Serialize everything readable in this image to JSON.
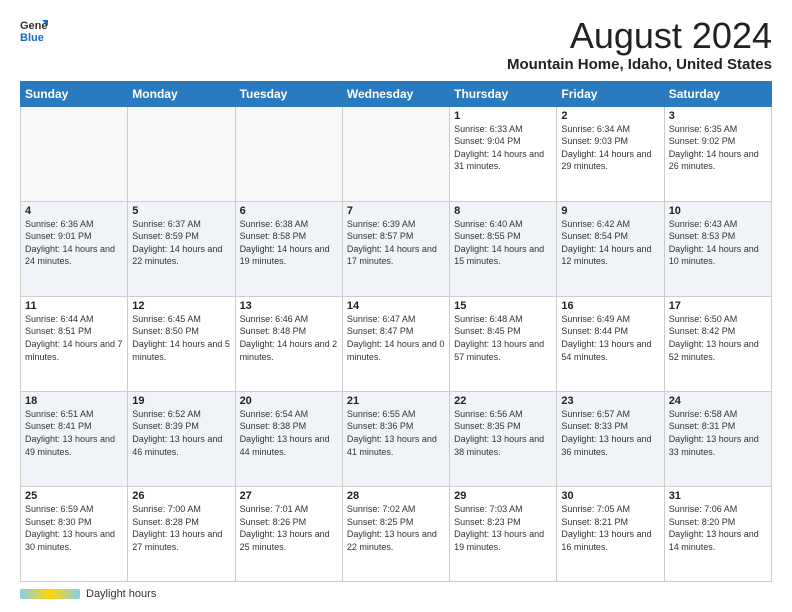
{
  "header": {
    "logo_general": "General",
    "logo_blue": "Blue",
    "main_title": "August 2024",
    "subtitle": "Mountain Home, Idaho, United States"
  },
  "days_of_week": [
    "Sunday",
    "Monday",
    "Tuesday",
    "Wednesday",
    "Thursday",
    "Friday",
    "Saturday"
  ],
  "weeks": [
    [
      {
        "day": "",
        "info": ""
      },
      {
        "day": "",
        "info": ""
      },
      {
        "day": "",
        "info": ""
      },
      {
        "day": "",
        "info": ""
      },
      {
        "day": "1",
        "info": "Sunrise: 6:33 AM\nSunset: 9:04 PM\nDaylight: 14 hours and 31 minutes."
      },
      {
        "day": "2",
        "info": "Sunrise: 6:34 AM\nSunset: 9:03 PM\nDaylight: 14 hours and 29 minutes."
      },
      {
        "day": "3",
        "info": "Sunrise: 6:35 AM\nSunset: 9:02 PM\nDaylight: 14 hours and 26 minutes."
      }
    ],
    [
      {
        "day": "4",
        "info": "Sunrise: 6:36 AM\nSunset: 9:01 PM\nDaylight: 14 hours and 24 minutes."
      },
      {
        "day": "5",
        "info": "Sunrise: 6:37 AM\nSunset: 8:59 PM\nDaylight: 14 hours and 22 minutes."
      },
      {
        "day": "6",
        "info": "Sunrise: 6:38 AM\nSunset: 8:58 PM\nDaylight: 14 hours and 19 minutes."
      },
      {
        "day": "7",
        "info": "Sunrise: 6:39 AM\nSunset: 8:57 PM\nDaylight: 14 hours and 17 minutes."
      },
      {
        "day": "8",
        "info": "Sunrise: 6:40 AM\nSunset: 8:55 PM\nDaylight: 14 hours and 15 minutes."
      },
      {
        "day": "9",
        "info": "Sunrise: 6:42 AM\nSunset: 8:54 PM\nDaylight: 14 hours and 12 minutes."
      },
      {
        "day": "10",
        "info": "Sunrise: 6:43 AM\nSunset: 8:53 PM\nDaylight: 14 hours and 10 minutes."
      }
    ],
    [
      {
        "day": "11",
        "info": "Sunrise: 6:44 AM\nSunset: 8:51 PM\nDaylight: 14 hours and 7 minutes."
      },
      {
        "day": "12",
        "info": "Sunrise: 6:45 AM\nSunset: 8:50 PM\nDaylight: 14 hours and 5 minutes."
      },
      {
        "day": "13",
        "info": "Sunrise: 6:46 AM\nSunset: 8:48 PM\nDaylight: 14 hours and 2 minutes."
      },
      {
        "day": "14",
        "info": "Sunrise: 6:47 AM\nSunset: 8:47 PM\nDaylight: 14 hours and 0 minutes."
      },
      {
        "day": "15",
        "info": "Sunrise: 6:48 AM\nSunset: 8:45 PM\nDaylight: 13 hours and 57 minutes."
      },
      {
        "day": "16",
        "info": "Sunrise: 6:49 AM\nSunset: 8:44 PM\nDaylight: 13 hours and 54 minutes."
      },
      {
        "day": "17",
        "info": "Sunrise: 6:50 AM\nSunset: 8:42 PM\nDaylight: 13 hours and 52 minutes."
      }
    ],
    [
      {
        "day": "18",
        "info": "Sunrise: 6:51 AM\nSunset: 8:41 PM\nDaylight: 13 hours and 49 minutes."
      },
      {
        "day": "19",
        "info": "Sunrise: 6:52 AM\nSunset: 8:39 PM\nDaylight: 13 hours and 46 minutes."
      },
      {
        "day": "20",
        "info": "Sunrise: 6:54 AM\nSunset: 8:38 PM\nDaylight: 13 hours and 44 minutes."
      },
      {
        "day": "21",
        "info": "Sunrise: 6:55 AM\nSunset: 8:36 PM\nDaylight: 13 hours and 41 minutes."
      },
      {
        "day": "22",
        "info": "Sunrise: 6:56 AM\nSunset: 8:35 PM\nDaylight: 13 hours and 38 minutes."
      },
      {
        "day": "23",
        "info": "Sunrise: 6:57 AM\nSunset: 8:33 PM\nDaylight: 13 hours and 36 minutes."
      },
      {
        "day": "24",
        "info": "Sunrise: 6:58 AM\nSunset: 8:31 PM\nDaylight: 13 hours and 33 minutes."
      }
    ],
    [
      {
        "day": "25",
        "info": "Sunrise: 6:59 AM\nSunset: 8:30 PM\nDaylight: 13 hours and 30 minutes."
      },
      {
        "day": "26",
        "info": "Sunrise: 7:00 AM\nSunset: 8:28 PM\nDaylight: 13 hours and 27 minutes."
      },
      {
        "day": "27",
        "info": "Sunrise: 7:01 AM\nSunset: 8:26 PM\nDaylight: 13 hours and 25 minutes."
      },
      {
        "day": "28",
        "info": "Sunrise: 7:02 AM\nSunset: 8:25 PM\nDaylight: 13 hours and 22 minutes."
      },
      {
        "day": "29",
        "info": "Sunrise: 7:03 AM\nSunset: 8:23 PM\nDaylight: 13 hours and 19 minutes."
      },
      {
        "day": "30",
        "info": "Sunrise: 7:05 AM\nSunset: 8:21 PM\nDaylight: 13 hours and 16 minutes."
      },
      {
        "day": "31",
        "info": "Sunrise: 7:06 AM\nSunset: 8:20 PM\nDaylight: 13 hours and 14 minutes."
      }
    ]
  ],
  "footer": {
    "daylight_label": "Daylight hours"
  }
}
